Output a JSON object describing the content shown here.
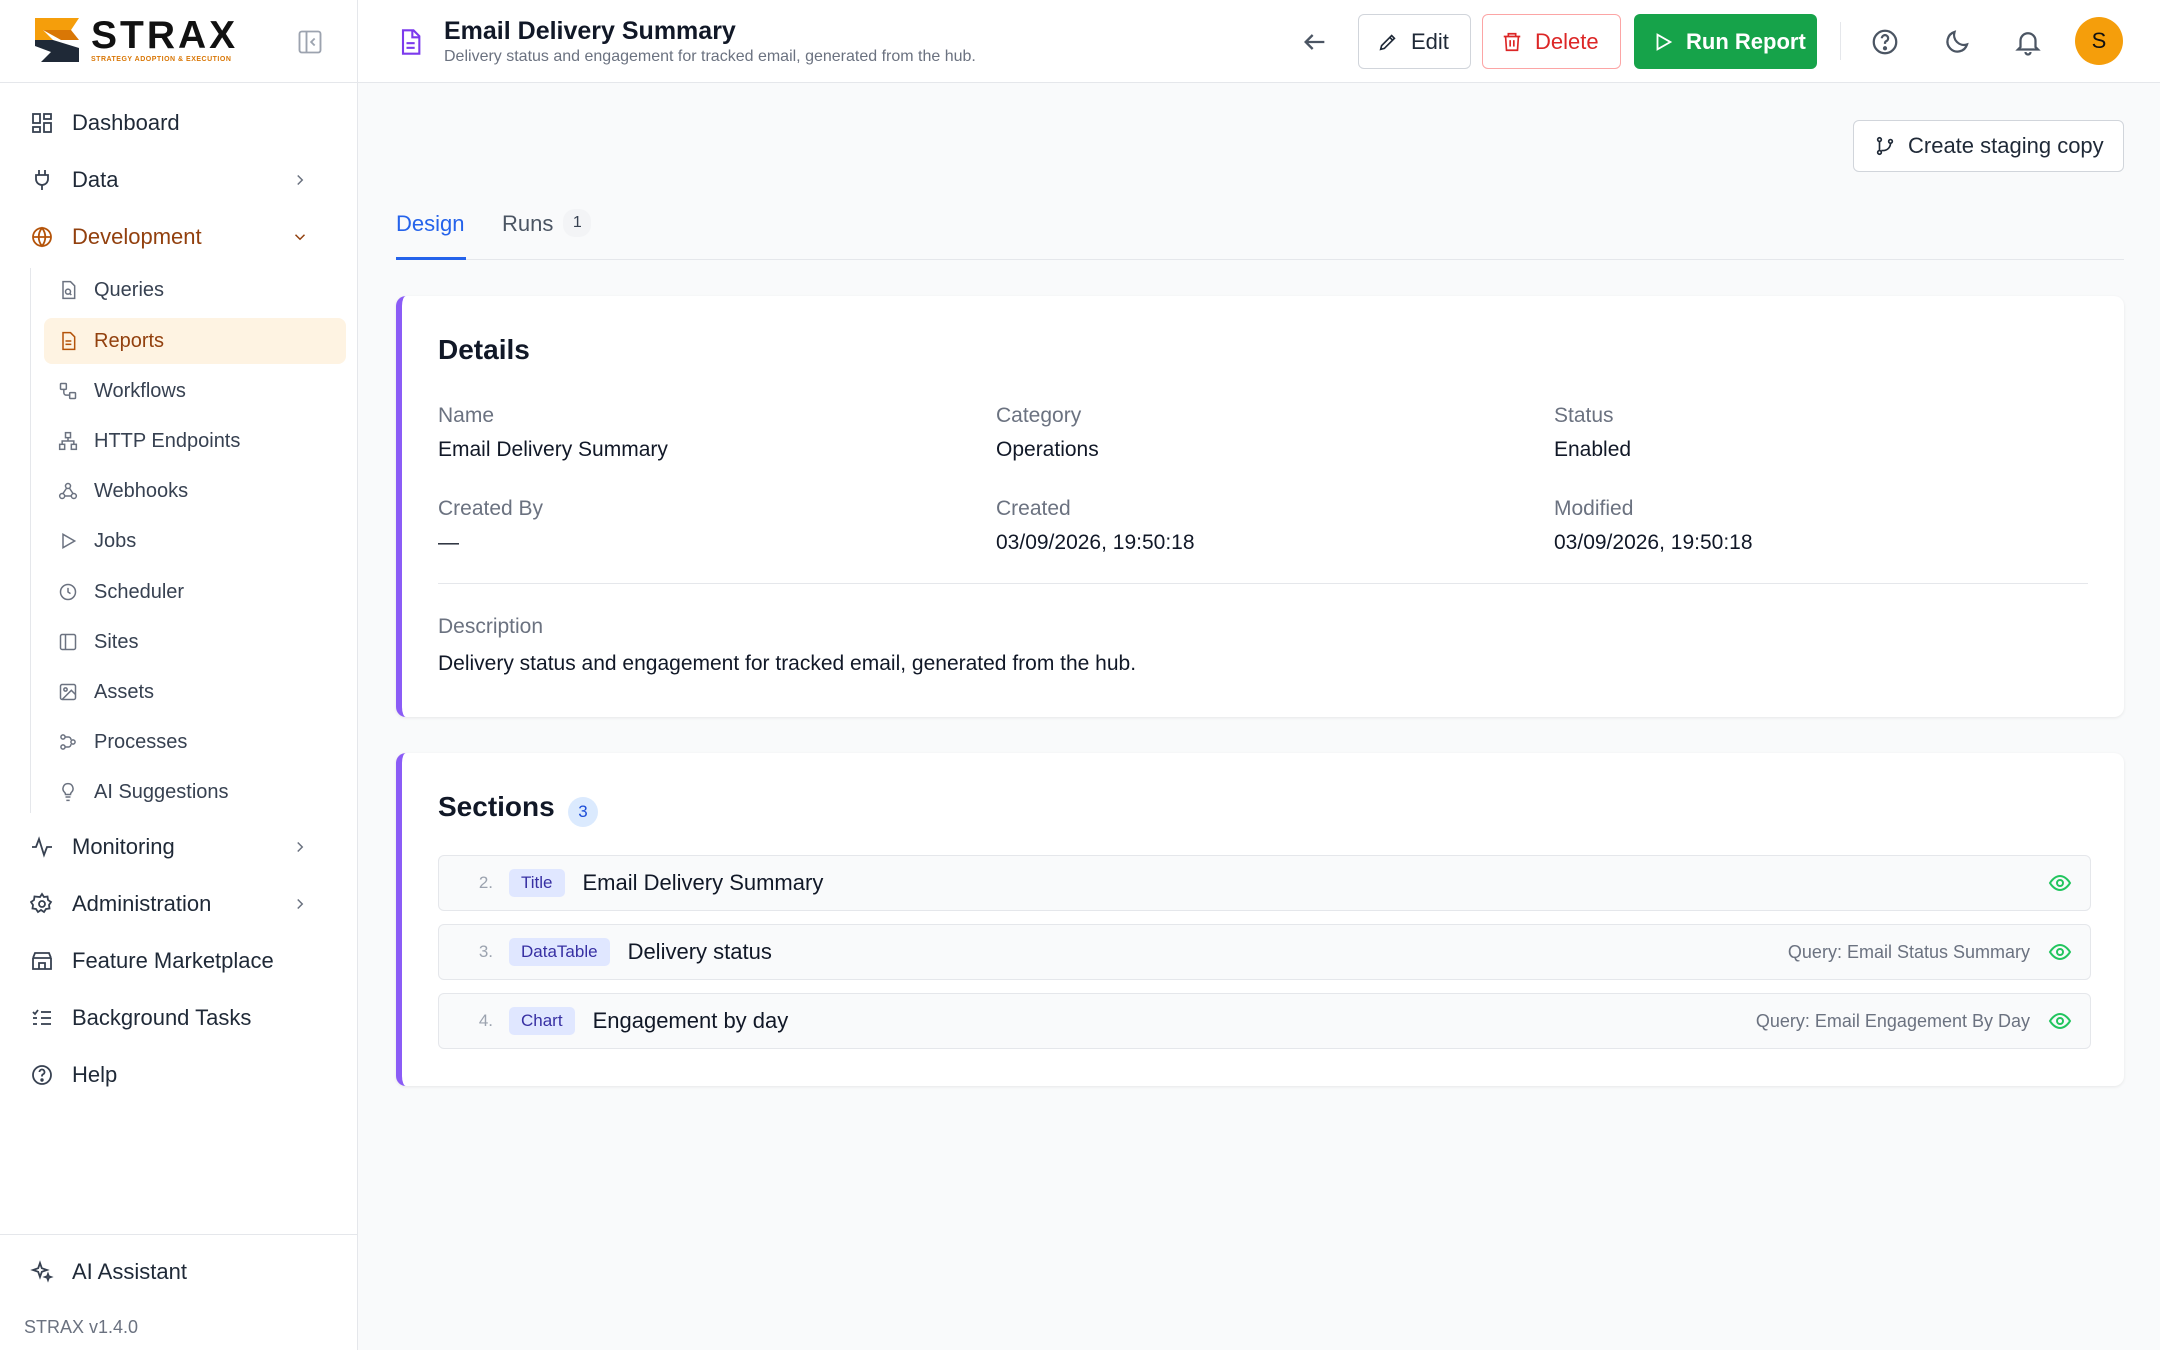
{
  "app": {
    "logo_word": "STRAX",
    "logo_tagline": "STRATEGY ADOPTION & EXECUTION",
    "version": "STRAX v1.4.0",
    "accent_color": "#b45309",
    "brand_color": "#f59e0b"
  },
  "sidebar": {
    "nav": [
      {
        "label": "Dashboard",
        "icon": "dashboard-icon"
      },
      {
        "label": "Data",
        "icon": "plug-icon"
      },
      {
        "label": "Development",
        "icon": "globe-icon"
      },
      {
        "label": "Monitoring",
        "icon": "activity-icon"
      },
      {
        "label": "Administration",
        "icon": "gear-icon"
      },
      {
        "label": "Feature Marketplace",
        "icon": "store-icon"
      },
      {
        "label": "Background Tasks",
        "icon": "task-list-icon"
      },
      {
        "label": "Help",
        "icon": "help-circle-icon"
      }
    ],
    "development_items": [
      {
        "label": "Queries",
        "icon": "query-file-icon"
      },
      {
        "label": "Reports",
        "icon": "report-file-icon"
      },
      {
        "label": "Workflows",
        "icon": "workflow-icon"
      },
      {
        "label": "HTTP Endpoints",
        "icon": "network-icon"
      },
      {
        "label": "Webhooks",
        "icon": "webhook-icon"
      },
      {
        "label": "Jobs",
        "icon": "play-icon"
      },
      {
        "label": "Scheduler",
        "icon": "clock-icon"
      },
      {
        "label": "Sites",
        "icon": "panel-icon"
      },
      {
        "label": "Assets",
        "icon": "image-icon"
      },
      {
        "label": "Processes",
        "icon": "process-icon"
      },
      {
        "label": "AI Suggestions",
        "icon": "lightbulb-icon"
      }
    ],
    "ai_assistant": "AI Assistant"
  },
  "header": {
    "title": "Email Delivery Summary",
    "subtitle": "Delivery status and engagement for tracked email, generated from the hub.",
    "edit_label": "Edit",
    "delete_label": "Delete",
    "run_label": "Run Report",
    "avatar_initial": "S"
  },
  "main": {
    "staging_label": "Create staging copy",
    "tabs": [
      {
        "label": "Design"
      },
      {
        "label": "Runs",
        "badge": "1"
      }
    ],
    "details": {
      "title": "Details",
      "name_label": "Name",
      "name_value": "Email Delivery Summary",
      "category_label": "Category",
      "category_value": "Operations",
      "status_label": "Status",
      "status_value": "Enabled",
      "created_by_label": "Created By",
      "created_by_value": "—",
      "created_label": "Created",
      "created_value": "03/09/2026, 19:50:18",
      "modified_label": "Modified",
      "modified_value": "03/09/2026, 19:50:18",
      "description_label": "Description",
      "description_value": "Delivery status and engagement for tracked email, generated from the hub."
    },
    "sections": {
      "title": "Sections",
      "count": "3",
      "rows": [
        {
          "num": "2.",
          "type": "Title",
          "name": "Email Delivery Summary",
          "query": ""
        },
        {
          "num": "3.",
          "type": "DataTable",
          "name": "Delivery status",
          "query": "Query: Email Status Summary"
        },
        {
          "num": "4.",
          "type": "Chart",
          "name": "Engagement by day",
          "query": "Query: Email Engagement By Day"
        }
      ]
    }
  }
}
